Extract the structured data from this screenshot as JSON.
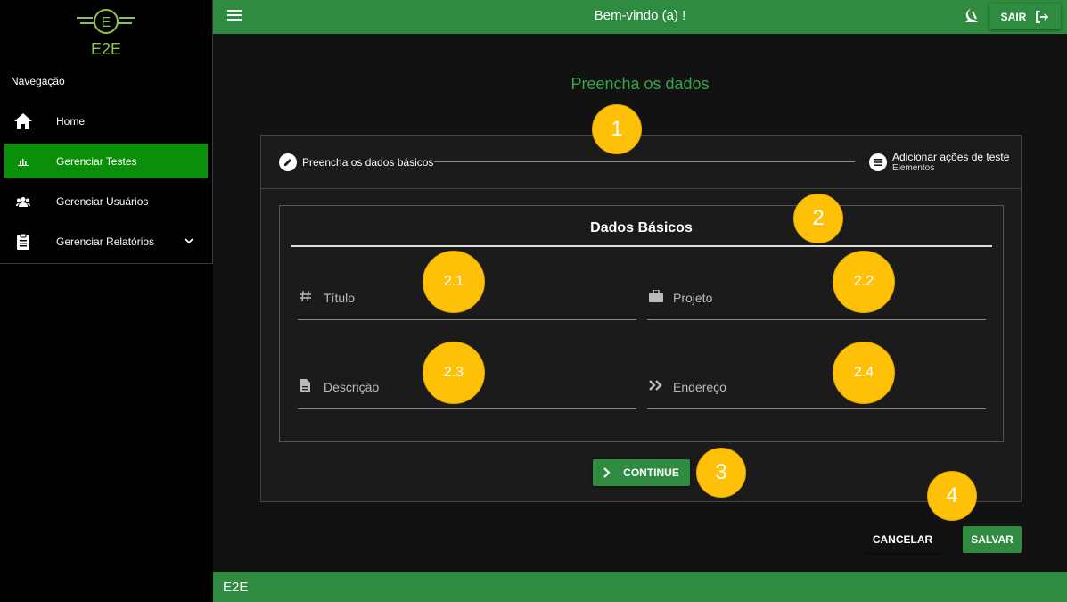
{
  "sidebar": {
    "logo_letter": "E",
    "logo_text": "E2E",
    "heading": "Navegação",
    "items": [
      {
        "label": "Home",
        "icon": "home-icon"
      },
      {
        "label": "Gerenciar Testes",
        "icon": "chart-icon",
        "active": true
      },
      {
        "label": "Gerenciar Usuários",
        "icon": "users-icon"
      },
      {
        "label": "Gerenciar Relatórios",
        "icon": "clipboard-icon",
        "expandable": true
      }
    ]
  },
  "header": {
    "welcome": "Bem-vindo (a) !",
    "logout_label": "SAIR"
  },
  "main": {
    "title": "Preencha os dados",
    "stepper": {
      "step1": "Preencha os dados básicos",
      "step2_title": "Adicionar ações de teste",
      "step2_sub": "Elementos"
    },
    "box_title": "Dados Básicos",
    "fields": {
      "titulo": "Título",
      "projeto": "Projeto",
      "descricao": "Descrição",
      "endereco": "Endereço"
    },
    "continue_label": "CONTINUE",
    "cancel_label": "CANCELAR",
    "save_label": "SALVAR"
  },
  "markers": {
    "m1": "1",
    "m2": "2",
    "m21": "2.1",
    "m22": "2.2",
    "m23": "2.3",
    "m24": "2.4",
    "m3": "3",
    "m4": "4"
  },
  "footer": {
    "text": "E2E"
  },
  "colors": {
    "accent": "#2e8b3f",
    "active": "#0b8f0b",
    "marker": "#ffc107",
    "title": "#3aa24b"
  }
}
